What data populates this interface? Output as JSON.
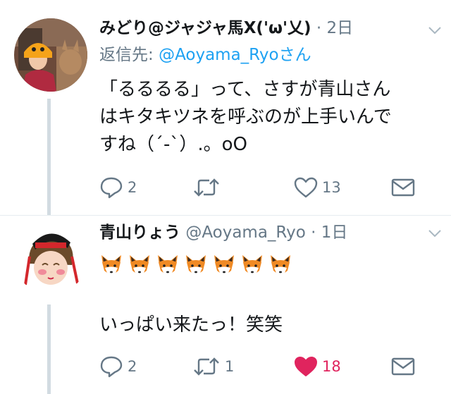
{
  "tweet1": {
    "display_name": "みどり@ジャジャ馬X('ω'乂)",
    "separator": "·",
    "time": "2日",
    "reply_label": "返信先:",
    "reply_handle": "@Aoyama_Ryoさん",
    "text_line1": "「るるるる」って、さすが青山さん",
    "text_line2": "はキタキツネを呼ぶのが上手いんで",
    "text_line3": "すね（´-`）.。oO",
    "reply_count": "2",
    "retweet_count": "",
    "like_count": "13"
  },
  "tweet2": {
    "display_name": "青山りょう",
    "handle": "@Aoyama_Ryo",
    "separator": "·",
    "time": "1日",
    "emoji": "fox-face",
    "emoji_count": 7,
    "text": "いっぱい来たっ！笑笑",
    "reply_count": "2",
    "retweet_count": "1",
    "like_count": "18"
  },
  "colors": {
    "link": "#1da1f2",
    "meta": "#657786",
    "like_active": "#e0245e",
    "thread_line": "#d2dbe1"
  }
}
